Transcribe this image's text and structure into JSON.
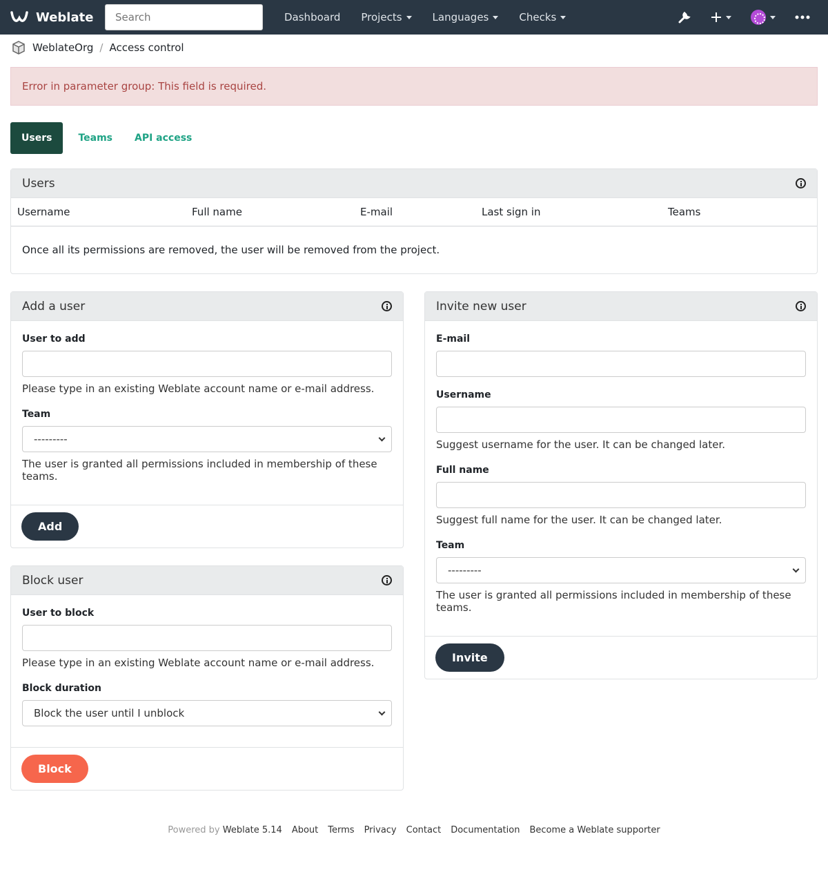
{
  "nav": {
    "brand": "Weblate",
    "search_placeholder": "Search",
    "links": [
      "Dashboard",
      "Projects",
      "Languages",
      "Checks"
    ]
  },
  "breadcrumb": {
    "project": "WeblateOrg",
    "page": "Access control"
  },
  "alert": {
    "message": "Error in parameter group: This field is required."
  },
  "tabs": [
    "Users",
    "Teams",
    "API access"
  ],
  "users_panel": {
    "title": "Users",
    "columns": [
      "Username",
      "Full name",
      "E-mail",
      "Last sign in",
      "Teams"
    ],
    "note": "Once all its permissions are removed, the user will be removed from the project."
  },
  "add_user": {
    "title": "Add a user",
    "user_label": "User to add",
    "user_help": "Please type in an existing Weblate account name or e-mail address.",
    "team_label": "Team",
    "team_value": "---------",
    "team_help": "The user is granted all permissions included in membership of these teams.",
    "button": "Add"
  },
  "block_user": {
    "title": "Block user",
    "user_label": "User to block",
    "user_help": "Please type in an existing Weblate account name or e-mail address.",
    "duration_label": "Block duration",
    "duration_value": "Block the user until I unblock",
    "button": "Block"
  },
  "invite_user": {
    "title": "Invite new user",
    "email_label": "E-mail",
    "username_label": "Username",
    "username_help": "Suggest username for the user. It can be changed later.",
    "fullname_label": "Full name",
    "fullname_help": "Suggest full name for the user. It can be changed later.",
    "team_label": "Team",
    "team_value": "---------",
    "team_help": "The user is granted all permissions included in membership of these teams.",
    "button": "Invite"
  },
  "footer": {
    "powered_by": "Powered by",
    "links": [
      "Weblate 5.14",
      "About",
      "Terms",
      "Privacy",
      "Contact",
      "Documentation",
      "Become a Weblate supporter"
    ]
  },
  "colors": {
    "navbar": "#2a3744",
    "accent": "#1fa385",
    "danger": "#f6664c",
    "alert_bg": "#f2dede"
  }
}
